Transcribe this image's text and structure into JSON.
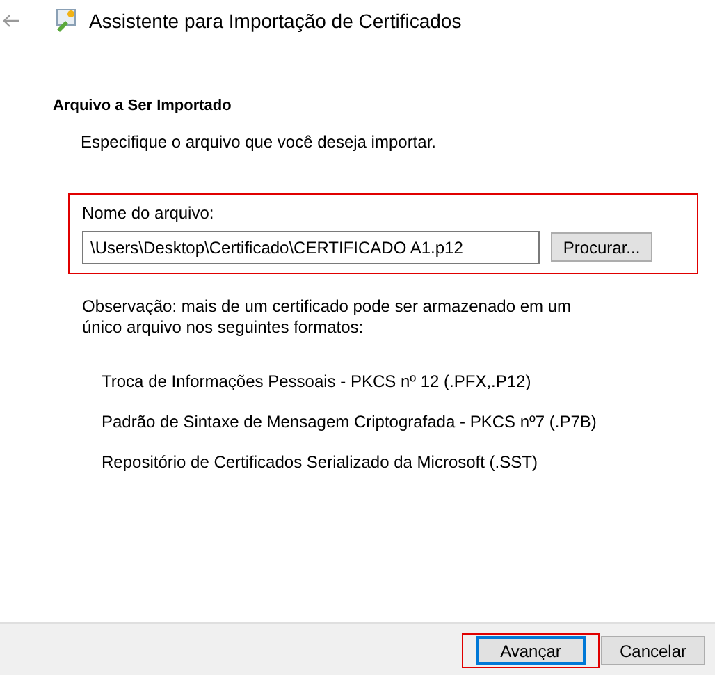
{
  "window": {
    "title": "Assistente para Importação de Certificados"
  },
  "header": {
    "title": "Arquivo a Ser Importado",
    "subtitle": "Especifique o arquivo que você deseja importar."
  },
  "file_field": {
    "label": "Nome do arquivo:",
    "value": "\\Users\\Desktop\\Certificado\\CERTIFICADO A1.p12",
    "browse_button": "Procurar...",
    "highlighted": true
  },
  "note": "Observação: mais de um certificado pode ser armazenado em um único arquivo nos seguintes formatos:",
  "formats": [
    "Troca de Informações Pessoais - PKCS nº 12 (.PFX,.P12)",
    "Padrão de Sintaxe de Mensagem Criptografada - PKCS nº7 (.P7B)",
    "Repositório de Certificados Serializado da Microsoft (.SST)"
  ],
  "buttons": [
    {
      "label": "Avançar",
      "default": true,
      "highlighted": true
    },
    {
      "label": "Cancelar",
      "default": false,
      "highlighted": false
    }
  ]
}
